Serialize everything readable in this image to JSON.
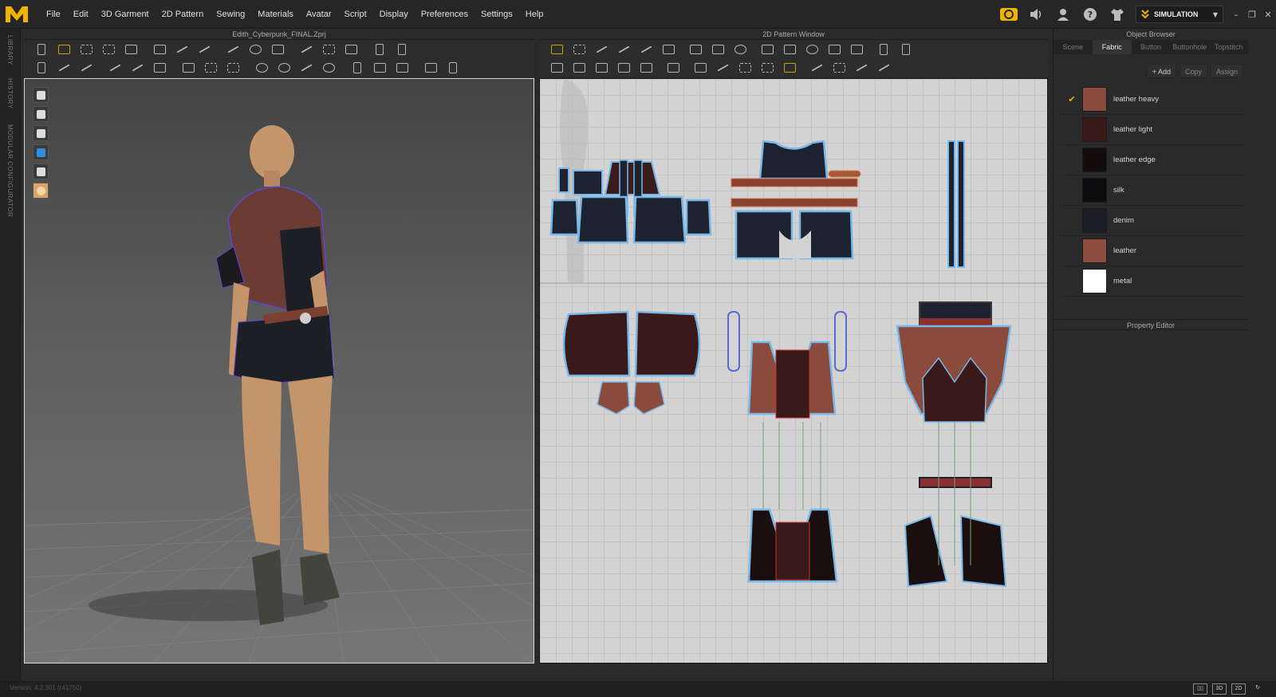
{
  "app": {
    "logo": "marvelous-logo",
    "accent": "#f0b400"
  },
  "menu": [
    {
      "label": "File"
    },
    {
      "label": "Edit"
    },
    {
      "label": "3D Garment"
    },
    {
      "label": "2D Pattern"
    },
    {
      "label": "Sewing"
    },
    {
      "label": "Materials"
    },
    {
      "label": "Avatar"
    },
    {
      "label": "Script"
    },
    {
      "label": "Display"
    },
    {
      "label": "Preferences"
    },
    {
      "label": "Settings"
    },
    {
      "label": "Help"
    }
  ],
  "topright": {
    "mode_label": "SIMULATION",
    "icons": [
      "cloud-sync-icon",
      "speaker-icon",
      "user-icon",
      "help-icon",
      "garment-icon"
    ]
  },
  "left_tabs": [
    "LIBRARY",
    "HISTORY",
    "MODULAR CONFIGURATOR"
  ],
  "view3d": {
    "title": "Edith_Cyberpunk_FINAL.Zprj"
  },
  "view2d": {
    "title": "2D Pattern Window"
  },
  "object_browser": {
    "title": "Object Browser",
    "tabs": [
      "Scene",
      "Fabric",
      "Button",
      "Buttonhole",
      "Topstitch"
    ],
    "active_tab": "Fabric",
    "actions": {
      "add": "+ Add",
      "copy": "Copy",
      "assign": "Assign"
    },
    "fabrics": [
      {
        "name": "leather heavy",
        "color": "#8a4a3c",
        "selected": true
      },
      {
        "name": "leather light",
        "color": "#3a1a18",
        "selected": false
      },
      {
        "name": "leather edge",
        "color": "#120c0c",
        "selected": false
      },
      {
        "name": "silk",
        "color": "#0c0c0e",
        "selected": false
      },
      {
        "name": "denim",
        "color": "#1c1f28",
        "selected": false
      },
      {
        "name": "leather",
        "color": "#8e4c3e",
        "selected": false
      },
      {
        "name": "metal",
        "color": "#ffffff",
        "selected": false
      }
    ]
  },
  "property_editor": {
    "title": "Property Editor"
  },
  "status": {
    "version": "Version: 4.2.301 (r41750)"
  }
}
